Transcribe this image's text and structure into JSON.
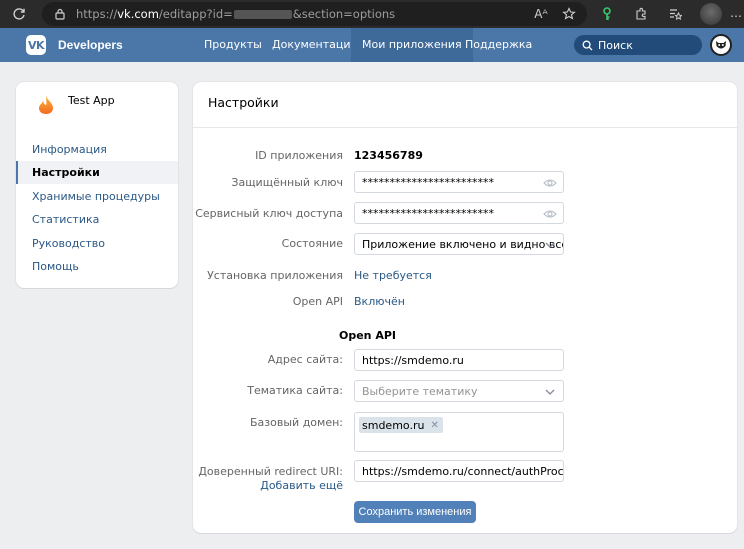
{
  "browser": {
    "url_prefix": "https://",
    "url_host": "vk.com",
    "url_path": "/editapp?id=",
    "url_suffix": "&section=options"
  },
  "header": {
    "brand": "Developers",
    "logo_text": "VK",
    "nav": [
      "Продукты",
      "Документация",
      "Мои приложения",
      "Поддержка"
    ],
    "active_nav": "Мои приложения",
    "search_label": "Поиск"
  },
  "sidebar": {
    "app_name": "Test App",
    "items": [
      {
        "label": "Информация"
      },
      {
        "label": "Настройки"
      },
      {
        "label": "Хранимые процедуры"
      },
      {
        "label": "Статистика"
      },
      {
        "label": "Руководство"
      },
      {
        "label": "Помощь"
      }
    ],
    "active": "Настройки"
  },
  "settings": {
    "title": "Настройки",
    "app_id_label": "ID приложения",
    "app_id_value": "123456789",
    "secure_key_label": "Защищённый ключ",
    "secure_key_value": "************************",
    "service_key_label": "Сервисный ключ доступа",
    "service_key_value": "************************",
    "state_label": "Состояние",
    "state_value": "Приложение включено и видно всем",
    "install_label": "Установка приложения",
    "install_value": "Не требуется",
    "open_api_label": "Open API",
    "open_api_value": "Включён",
    "open_api_section": "Open API",
    "site_address_label": "Адрес сайта:",
    "site_address_value": "https://smdemo.ru",
    "site_theme_label": "Тематика сайта:",
    "site_theme_placeholder": "Выберите тематику",
    "base_domain_label": "Базовый домен:",
    "base_domain_tag": "smdemo.ru",
    "redirect_label": "Доверенный redirect URI:",
    "redirect_value": "https://smdemo.ru/connect/authProcess/vk",
    "add_more": "Добавить ещё",
    "save_button": "Сохранить изменения"
  },
  "colors": {
    "vk_header": "#4a76a8",
    "link": "#2a5885",
    "button": "#5181b8",
    "page_bg": "#edeef0"
  }
}
